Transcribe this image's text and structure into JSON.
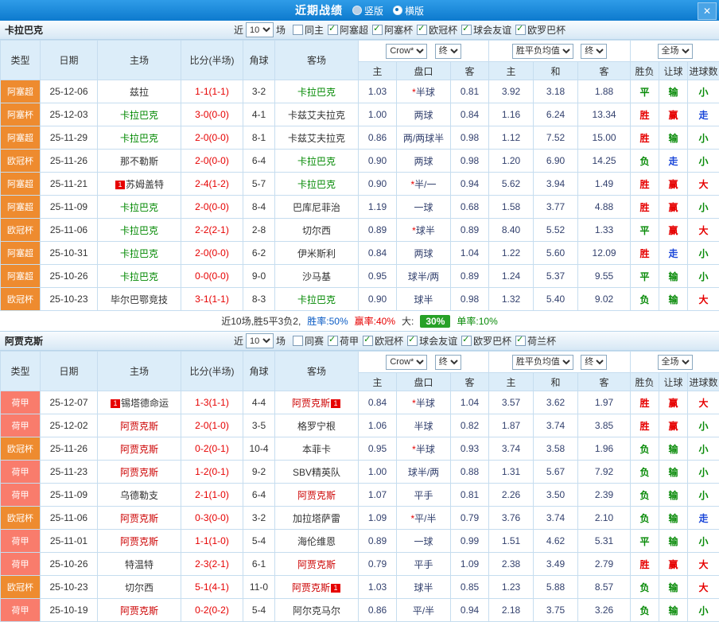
{
  "header": {
    "title": "近期战绩",
    "layouts": [
      {
        "label": "竖版",
        "selected": false
      },
      {
        "label": "横版",
        "selected": true
      }
    ],
    "close_glyph": "✕"
  },
  "colors": {
    "topbar_blue": "#0d7ace",
    "league_orange": "#ee8b2f",
    "league_salmon": "#f97c6c",
    "team1_highlight": "#008800",
    "team2_highlight": "#cc0000",
    "win_red": "#e60000",
    "lose_green": "#078a07",
    "push_blue": "#1a46d9",
    "summary_badge_green": "#27a127"
  },
  "outcome_colors": {
    "胜": "c-red",
    "赢": "c-red",
    "大": "c-red",
    "平": "c-green",
    "负": "c-green",
    "输": "c-green",
    "小": "c-green",
    "走": "c-blue"
  },
  "columns": {
    "left": [
      "类型",
      "日期",
      "主场",
      "比分(半场)",
      "角球",
      "客场"
    ],
    "asian": [
      "主",
      "盘口",
      "客"
    ],
    "euro": [
      "主",
      "和",
      "客"
    ],
    "right": [
      "胜负",
      "让球",
      "进球数"
    ]
  },
  "sections": [
    {
      "team": "卡拉巴克",
      "team_color": "#008800",
      "recent_label": "近",
      "match_count": "10",
      "matches_label": "场",
      "checkboxes": [
        {
          "label": "同主",
          "checked": false
        },
        {
          "label": "阿塞超",
          "checked": true
        },
        {
          "label": "阿塞杯",
          "checked": true
        },
        {
          "label": "欧冠杯",
          "checked": true
        },
        {
          "label": "球会友谊",
          "checked": true
        },
        {
          "label": "欧罗巴杯",
          "checked": true
        }
      ],
      "dropdowns": {
        "bookmaker": "Crow*",
        "asian_time": "终",
        "euro_type": "胜平负均值",
        "euro_time": "终",
        "scope": "全场"
      },
      "rows": [
        {
          "league": "阿塞超",
          "league_color": "#ee8b2f",
          "date": "25-12-06",
          "home": "兹拉",
          "home_hl": false,
          "score": "1-1(1-1)",
          "corner": "3-2",
          "away": "卡拉巴克",
          "away_hl": true,
          "odds": [
            "1.03",
            "*半球",
            "0.81",
            "3.92",
            "3.18",
            "1.88"
          ],
          "outcome": [
            "平",
            "输",
            "小"
          ]
        },
        {
          "league": "阿塞杯",
          "league_color": "#ee8b2f",
          "date": "25-12-03",
          "home": "卡拉巴克",
          "home_hl": true,
          "score": "3-0(0-0)",
          "corner": "4-1",
          "away": "卡兹艾夫拉克",
          "away_hl": false,
          "odds": [
            "1.00",
            "两球",
            "0.84",
            "1.16",
            "6.24",
            "13.34"
          ],
          "outcome": [
            "胜",
            "赢",
            "走"
          ]
        },
        {
          "league": "阿塞超",
          "league_color": "#ee8b2f",
          "date": "25-11-29",
          "home": "卡拉巴克",
          "home_hl": true,
          "score": "2-0(0-0)",
          "corner": "8-1",
          "away": "卡兹艾夫拉克",
          "away_hl": false,
          "odds": [
            "0.86",
            "两/两球半",
            "0.98",
            "1.12",
            "7.52",
            "15.00"
          ],
          "outcome": [
            "胜",
            "输",
            "小"
          ]
        },
        {
          "league": "欧冠杯",
          "league_color": "#ee8b2f",
          "date": "25-11-26",
          "home": "那不勒斯",
          "home_hl": false,
          "score": "2-0(0-0)",
          "corner": "6-4",
          "away": "卡拉巴克",
          "away_hl": true,
          "odds": [
            "0.90",
            "两球",
            "0.98",
            "1.20",
            "6.90",
            "14.25"
          ],
          "outcome": [
            "负",
            "走",
            "小"
          ]
        },
        {
          "league": "阿塞超",
          "league_color": "#ee8b2f",
          "date": "25-11-21",
          "home": "苏姆盖特",
          "home_hl": false,
          "home_badge_pre": "1",
          "score": "2-4(1-2)",
          "corner": "5-7",
          "away": "卡拉巴克",
          "away_hl": true,
          "odds": [
            "0.90",
            "*半/一",
            "0.94",
            "5.62",
            "3.94",
            "1.49"
          ],
          "outcome": [
            "胜",
            "赢",
            "大"
          ]
        },
        {
          "league": "阿塞超",
          "league_color": "#ee8b2f",
          "date": "25-11-09",
          "home": "卡拉巴克",
          "home_hl": true,
          "score": "2-0(0-0)",
          "corner": "8-4",
          "away": "巴库尼菲治",
          "away_hl": false,
          "odds": [
            "1.19",
            "一球",
            "0.68",
            "1.58",
            "3.77",
            "4.88"
          ],
          "outcome": [
            "胜",
            "赢",
            "小"
          ]
        },
        {
          "league": "欧冠杯",
          "league_color": "#ee8b2f",
          "date": "25-11-06",
          "home": "卡拉巴克",
          "home_hl": true,
          "score": "2-2(2-1)",
          "corner": "2-8",
          "away": "切尔西",
          "away_hl": false,
          "odds": [
            "0.89",
            "*球半",
            "0.89",
            "8.40",
            "5.52",
            "1.33"
          ],
          "outcome": [
            "平",
            "赢",
            "大"
          ]
        },
        {
          "league": "阿塞超",
          "league_color": "#ee8b2f",
          "date": "25-10-31",
          "home": "卡拉巴克",
          "home_hl": true,
          "score": "2-0(0-0)",
          "corner": "6-2",
          "away": "伊米斯利",
          "away_hl": false,
          "odds": [
            "0.84",
            "两球",
            "1.04",
            "1.22",
            "5.60",
            "12.09"
          ],
          "outcome": [
            "胜",
            "走",
            "小"
          ]
        },
        {
          "league": "阿塞超",
          "league_color": "#ee8b2f",
          "date": "25-10-26",
          "home": "卡拉巴克",
          "home_hl": true,
          "score": "0-0(0-0)",
          "corner": "9-0",
          "away": "沙马基",
          "away_hl": false,
          "odds": [
            "0.95",
            "球半/两",
            "0.89",
            "1.24",
            "5.37",
            "9.55"
          ],
          "outcome": [
            "平",
            "输",
            "小"
          ]
        },
        {
          "league": "欧冠杯",
          "league_color": "#ee8b2f",
          "date": "25-10-23",
          "home": "毕尔巴鄂竞技",
          "home_hl": false,
          "score": "3-1(1-1)",
          "corner": "8-3",
          "away": "卡拉巴克",
          "away_hl": true,
          "odds": [
            "0.90",
            "球半",
            "0.98",
            "1.32",
            "5.40",
            "9.02"
          ],
          "outcome": [
            "负",
            "输",
            "大"
          ]
        }
      ],
      "summary": {
        "main": "近10场,胜5平3负2,",
        "win_rate": "胜率:50%",
        "profit_rate": "赢率:40%",
        "big_label": "大:",
        "big_value": "30%",
        "odd_rate": "单率:10%"
      }
    },
    {
      "team": "阿贾克斯",
      "team_color": "#cc0000",
      "recent_label": "近",
      "match_count": "10",
      "matches_label": "场",
      "checkboxes": [
        {
          "label": "同赛",
          "checked": false
        },
        {
          "label": "荷甲",
          "checked": true
        },
        {
          "label": "欧冠杯",
          "checked": true
        },
        {
          "label": "球会友谊",
          "checked": true
        },
        {
          "label": "欧罗巴杯",
          "checked": true
        },
        {
          "label": "荷兰杯",
          "checked": true
        }
      ],
      "dropdowns": {
        "bookmaker": "Crow*",
        "asian_time": "终",
        "euro_type": "胜平负均值",
        "euro_time": "终",
        "scope": "全场"
      },
      "rows": [
        {
          "league": "荷甲",
          "league_color": "#f97c6c",
          "date": "25-12-07",
          "home": "锡塔德命运",
          "home_hl": false,
          "home_badge_pre": "1",
          "score": "1-3(1-1)",
          "corner": "4-4",
          "away": "阿贾克斯",
          "away_hl": true,
          "away_badge_post": "1",
          "odds": [
            "0.84",
            "*半球",
            "1.04",
            "3.57",
            "3.62",
            "1.97"
          ],
          "outcome": [
            "胜",
            "赢",
            "大"
          ]
        },
        {
          "league": "荷甲",
          "league_color": "#f97c6c",
          "date": "25-12-02",
          "home": "阿贾克斯",
          "home_hl": true,
          "score": "2-0(1-0)",
          "corner": "3-5",
          "away": "格罗宁根",
          "away_hl": false,
          "odds": [
            "1.06",
            "半球",
            "0.82",
            "1.87",
            "3.74",
            "3.85"
          ],
          "outcome": [
            "胜",
            "赢",
            "小"
          ]
        },
        {
          "league": "欧冠杯",
          "league_color": "#ee8b2f",
          "date": "25-11-26",
          "home": "阿贾克斯",
          "home_hl": true,
          "score": "0-2(0-1)",
          "corner": "10-4",
          "away": "本菲卡",
          "away_hl": false,
          "odds": [
            "0.95",
            "*半球",
            "0.93",
            "3.74",
            "3.58",
            "1.96"
          ],
          "outcome": [
            "负",
            "输",
            "小"
          ]
        },
        {
          "league": "荷甲",
          "league_color": "#f97c6c",
          "date": "25-11-23",
          "home": "阿贾克斯",
          "home_hl": true,
          "score": "1-2(0-1)",
          "corner": "9-2",
          "away": "SBV精英队",
          "away_hl": false,
          "odds": [
            "1.00",
            "球半/两",
            "0.88",
            "1.31",
            "5.67",
            "7.92"
          ],
          "outcome": [
            "负",
            "输",
            "小"
          ]
        },
        {
          "league": "荷甲",
          "league_color": "#f97c6c",
          "date": "25-11-09",
          "home": "乌德勒支",
          "home_hl": false,
          "score": "2-1(1-0)",
          "corner": "6-4",
          "away": "阿贾克斯",
          "away_hl": true,
          "odds": [
            "1.07",
            "平手",
            "0.81",
            "2.26",
            "3.50",
            "2.39"
          ],
          "outcome": [
            "负",
            "输",
            "小"
          ]
        },
        {
          "league": "欧冠杯",
          "league_color": "#ee8b2f",
          "date": "25-11-06",
          "home": "阿贾克斯",
          "home_hl": true,
          "score": "0-3(0-0)",
          "corner": "3-2",
          "away": "加拉塔萨雷",
          "away_hl": false,
          "odds": [
            "1.09",
            "*平/半",
            "0.79",
            "3.76",
            "3.74",
            "2.10"
          ],
          "outcome": [
            "负",
            "输",
            "走"
          ]
        },
        {
          "league": "荷甲",
          "league_color": "#f97c6c",
          "date": "25-11-01",
          "home": "阿贾克斯",
          "home_hl": true,
          "score": "1-1(1-0)",
          "corner": "5-4",
          "away": "海伦维恩",
          "away_hl": false,
          "odds": [
            "0.89",
            "一球",
            "0.99",
            "1.51",
            "4.62",
            "5.31"
          ],
          "outcome": [
            "平",
            "输",
            "小"
          ]
        },
        {
          "league": "荷甲",
          "league_color": "#f97c6c",
          "date": "25-10-26",
          "home": "特温特",
          "home_hl": false,
          "score": "2-3(2-1)",
          "corner": "6-1",
          "away": "阿贾克斯",
          "away_hl": true,
          "odds": [
            "0.79",
            "平手",
            "1.09",
            "2.38",
            "3.49",
            "2.79"
          ],
          "outcome": [
            "胜",
            "赢",
            "大"
          ]
        },
        {
          "league": "欧冠杯",
          "league_color": "#ee8b2f",
          "date": "25-10-23",
          "home": "切尔西",
          "home_hl": false,
          "score": "5-1(4-1)",
          "corner": "11-0",
          "away": "阿贾克斯",
          "away_hl": true,
          "away_badge_post": "1",
          "odds": [
            "1.03",
            "球半",
            "0.85",
            "1.23",
            "5.88",
            "8.57"
          ],
          "outcome": [
            "负",
            "输",
            "大"
          ]
        },
        {
          "league": "荷甲",
          "league_color": "#f97c6c",
          "date": "25-10-19",
          "home": "阿贾克斯",
          "home_hl": true,
          "score": "0-2(0-2)",
          "corner": "5-4",
          "away": "阿尔克马尔",
          "away_hl": false,
          "odds": [
            "0.86",
            "平/半",
            "0.94",
            "2.18",
            "3.75",
            "3.26"
          ],
          "outcome": [
            "负",
            "输",
            "小"
          ]
        }
      ],
      "summary": null
    }
  ]
}
